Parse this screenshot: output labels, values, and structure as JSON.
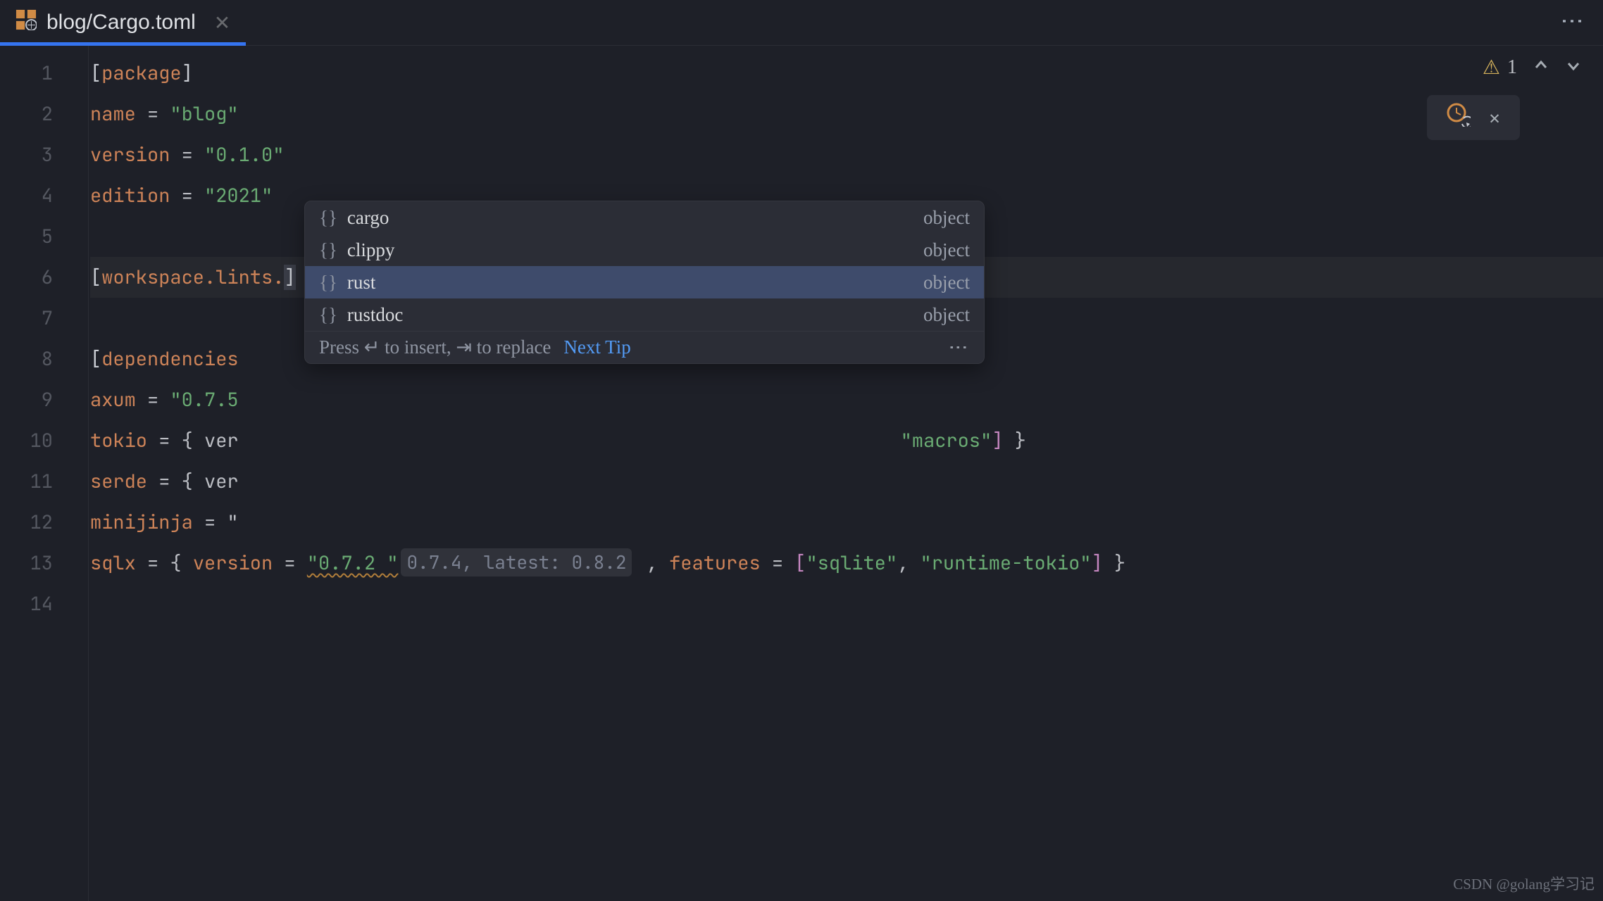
{
  "tab": {
    "title": "blog/Cargo.toml"
  },
  "inspection": {
    "warning_count": "1"
  },
  "gutter": [
    "1",
    "2",
    "3",
    "4",
    "5",
    "6",
    "7",
    "8",
    "9",
    "10",
    "11",
    "12",
    "13",
    "14"
  ],
  "crate_lines": [
    9,
    10,
    11,
    12,
    13
  ],
  "code": {
    "package_hdr": "package",
    "name_key": "name",
    "name_val": "\"blog\"",
    "version_key": "version",
    "version_val": "\"0.1.0\"",
    "edition_key": "edition",
    "edition_val": "\"2021\"",
    "ws_lints": "workspace.lints.",
    "deps_hdr": "dependencies",
    "axum_key": "axum",
    "axum_val": "\"0.7.5",
    "tokio_key": "tokio",
    "tokio_frag": " = { ver",
    "tokio_tail_feat": "\"macros\"",
    "serde_key": "serde",
    "serde_frag": " = { ver",
    "mini_key": "minijinja",
    "mini_frag": " = \"",
    "sqlx_key": "sqlx",
    "sqlx_verkey": "version",
    "sqlx_verval": "\"0.7.2 \"",
    "sqlx_inlay": "0.7.4, latest: 0.8.2",
    "sqlx_featkey": "features",
    "sqlx_f1": "\"sqlite\"",
    "sqlx_f2": "\"runtime-tokio\""
  },
  "completion": {
    "items": [
      {
        "label": "cargo",
        "type": "object"
      },
      {
        "label": "clippy",
        "type": "object"
      },
      {
        "label": "rust",
        "type": "object"
      },
      {
        "label": "rustdoc",
        "type": "object"
      }
    ],
    "selected_index": 2,
    "hint_prefix": "Press ↵ to insert, ⇥ to replace",
    "hint_link": "Next Tip",
    "kind_glyph": "{}"
  },
  "watermark": "CSDN @golang学习记"
}
